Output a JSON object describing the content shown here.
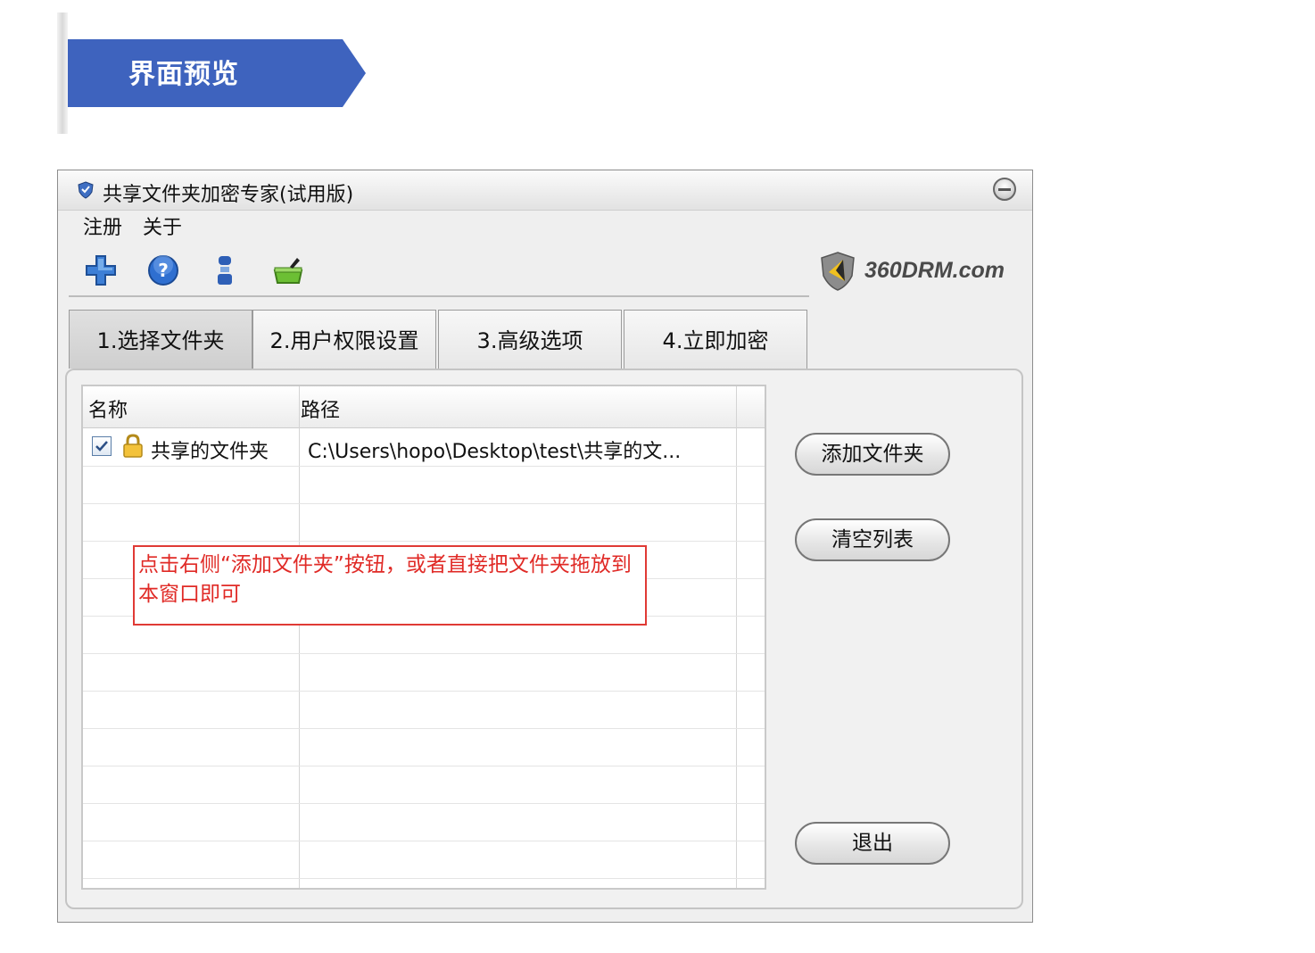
{
  "banner": {
    "title": "界面预览"
  },
  "window": {
    "title": "共享文件夹加密专家(试用版)",
    "menu": [
      "注册",
      "关于"
    ],
    "brand": "360DRM.com",
    "tabs": [
      "1.选择文件夹",
      "2.用户权限设置",
      "3.高级选项",
      "4.立即加密"
    ],
    "active_tab": 0,
    "list": {
      "columns": [
        "名称",
        "路径"
      ],
      "rows": [
        {
          "checked": true,
          "name": "共享的文件夹",
          "path": "C:\\Users\\hopo\\Desktop\\test\\共享的文..."
        }
      ]
    },
    "hint": "点击右侧“添加文件夹”按钮，或者直接把文件夹拖放到本窗口即可",
    "buttons": {
      "add": "添加文件夹",
      "clear": "清空列表",
      "exit": "退出"
    },
    "icons": [
      "plus-icon",
      "help-icon",
      "user-icon",
      "folder-key-icon"
    ],
    "colors": {
      "banner": "#3e63be",
      "hint_border": "#e03a35",
      "hint_text": "#e02a26"
    }
  }
}
